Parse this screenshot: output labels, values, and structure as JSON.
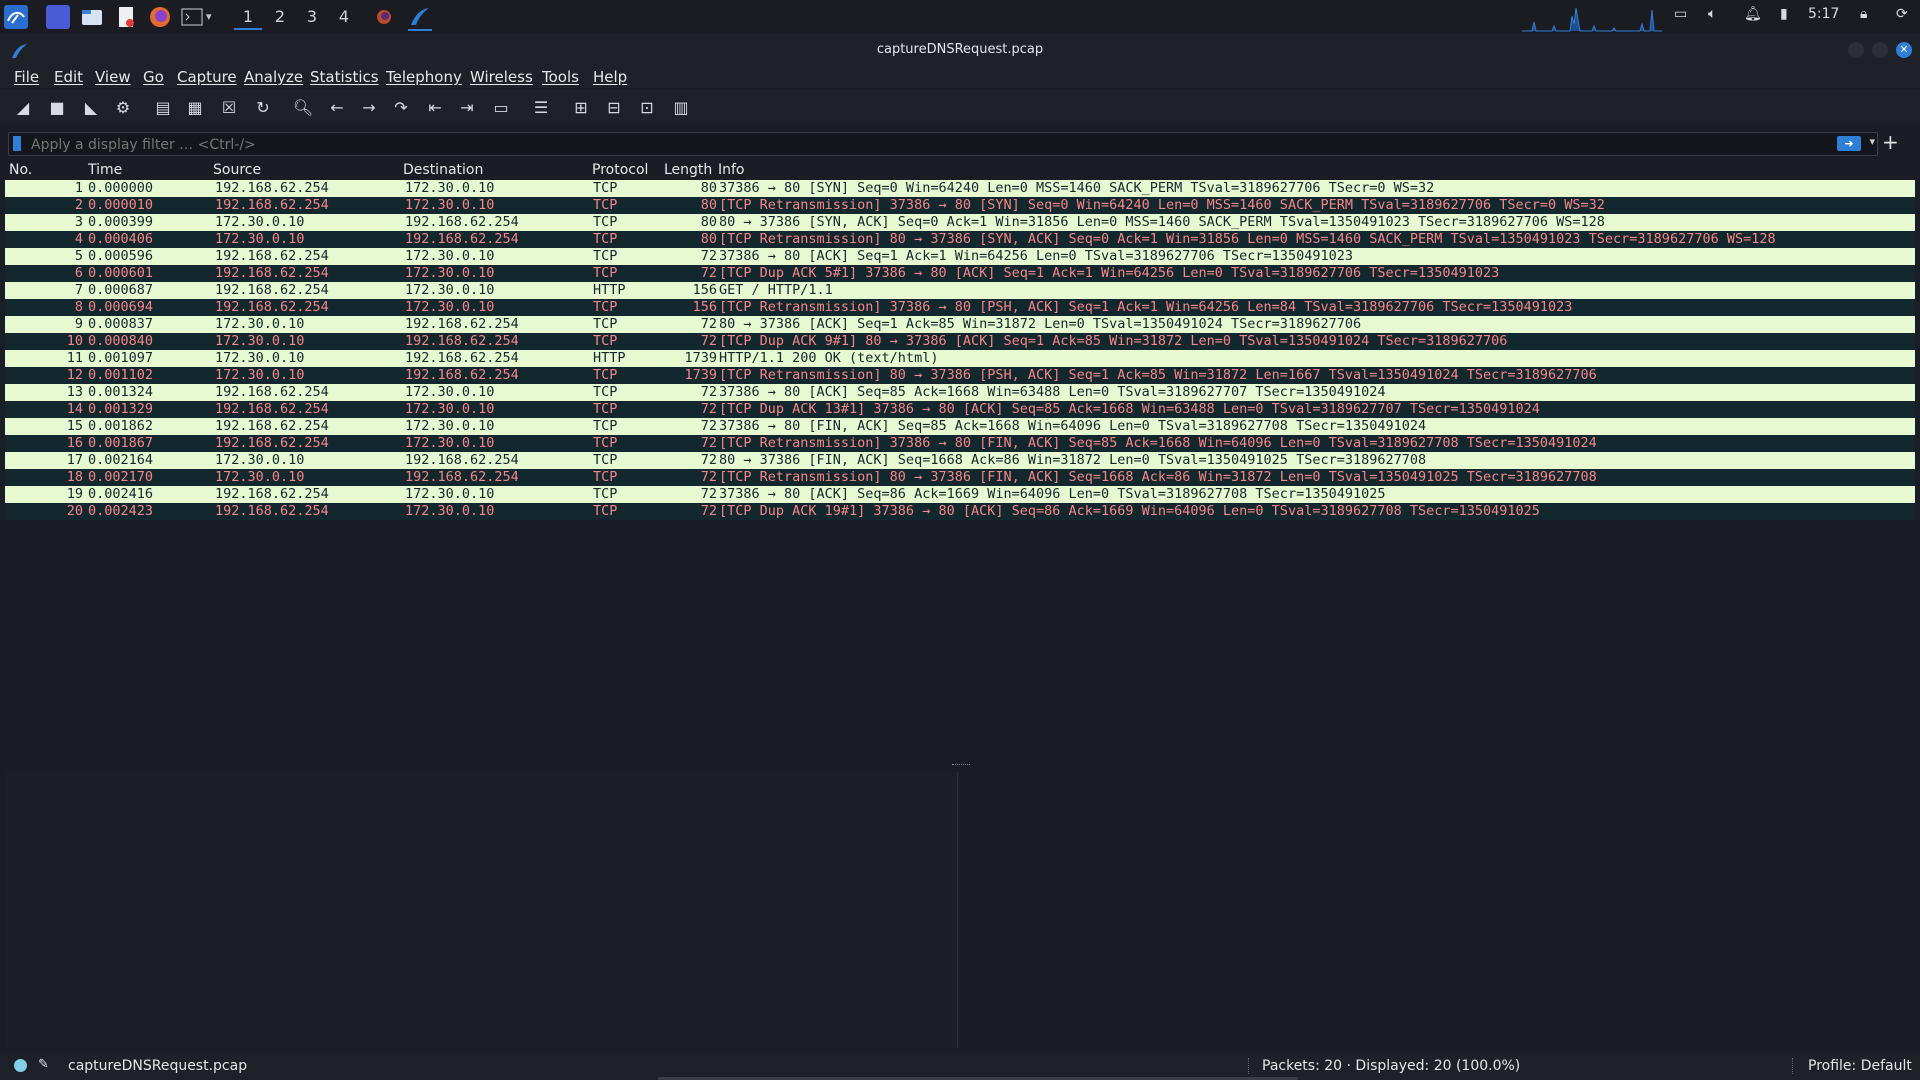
{
  "taskbar": {
    "workspaces": [
      "1",
      "2",
      "3",
      "4"
    ],
    "clock": "5:17"
  },
  "window": {
    "title": "captureDNSRequest.pcap"
  },
  "menu": [
    "File",
    "Edit",
    "View",
    "Go",
    "Capture",
    "Analyze",
    "Statistics",
    "Telephony",
    "Wireless",
    "Tools",
    "Help"
  ],
  "filter": {
    "placeholder": "Apply a display filter … <Ctrl-/>"
  },
  "columns": {
    "no": "No.",
    "time": "Time",
    "source": "Source",
    "destination": "Destination",
    "protocol": "Protocol",
    "length": "Length",
    "info": "Info"
  },
  "packets": [
    {
      "no": "1",
      "time": "0.000000",
      "src": "192.168.62.254",
      "dst": "172.30.0.10",
      "proto": "TCP",
      "len": "80",
      "info": "37386 → 80 [SYN] Seq=0 Win=64240 Len=0 MSS=1460 SACK_PERM TSval=3189627706 TSecr=0 WS=32",
      "style": "normal"
    },
    {
      "no": "2",
      "time": "0.000010",
      "src": "192.168.62.254",
      "dst": "172.30.0.10",
      "proto": "TCP",
      "len": "80",
      "info": "[TCP Retransmission] 37386 → 80 [SYN] Seq=0 Win=64240 Len=0 MSS=1460 SACK_PERM TSval=3189627706 TSecr=0 WS=32",
      "style": "bad"
    },
    {
      "no": "3",
      "time": "0.000399",
      "src": "172.30.0.10",
      "dst": "192.168.62.254",
      "proto": "TCP",
      "len": "80",
      "info": "80 → 37386 [SYN, ACK] Seq=0 Ack=1 Win=31856 Len=0 MSS=1460 SACK_PERM TSval=1350491023 TSecr=3189627706 WS=128",
      "style": "normal"
    },
    {
      "no": "4",
      "time": "0.000406",
      "src": "172.30.0.10",
      "dst": "192.168.62.254",
      "proto": "TCP",
      "len": "80",
      "info": "[TCP Retransmission] 80 → 37386 [SYN, ACK] Seq=0 Ack=1 Win=31856 Len=0 MSS=1460 SACK_PERM TSval=1350491023 TSecr=3189627706 WS=128",
      "style": "bad"
    },
    {
      "no": "5",
      "time": "0.000596",
      "src": "192.168.62.254",
      "dst": "172.30.0.10",
      "proto": "TCP",
      "len": "72",
      "info": "37386 → 80 [ACK] Seq=1 Ack=1 Win=64256 Len=0 TSval=3189627706 TSecr=1350491023",
      "style": "normal"
    },
    {
      "no": "6",
      "time": "0.000601",
      "src": "192.168.62.254",
      "dst": "172.30.0.10",
      "proto": "TCP",
      "len": "72",
      "info": "[TCP Dup ACK 5#1] 37386 → 80 [ACK] Seq=1 Ack=1 Win=64256 Len=0 TSval=3189627706 TSecr=1350491023",
      "style": "bad"
    },
    {
      "no": "7",
      "time": "0.000687",
      "src": "192.168.62.254",
      "dst": "172.30.0.10",
      "proto": "HTTP",
      "len": "156",
      "info": "GET / HTTP/1.1",
      "style": "normal"
    },
    {
      "no": "8",
      "time": "0.000694",
      "src": "192.168.62.254",
      "dst": "172.30.0.10",
      "proto": "TCP",
      "len": "156",
      "info": "[TCP Retransmission] 37386 → 80 [PSH, ACK] Seq=1 Ack=1 Win=64256 Len=84 TSval=3189627706 TSecr=1350491023",
      "style": "bad"
    },
    {
      "no": "9",
      "time": "0.000837",
      "src": "172.30.0.10",
      "dst": "192.168.62.254",
      "proto": "TCP",
      "len": "72",
      "info": "80 → 37386 [ACK] Seq=1 Ack=85 Win=31872 Len=0 TSval=1350491024 TSecr=3189627706",
      "style": "normal"
    },
    {
      "no": "10",
      "time": "0.000840",
      "src": "172.30.0.10",
      "dst": "192.168.62.254",
      "proto": "TCP",
      "len": "72",
      "info": "[TCP Dup ACK 9#1] 80 → 37386 [ACK] Seq=1 Ack=85 Win=31872 Len=0 TSval=1350491024 TSecr=3189627706",
      "style": "bad"
    },
    {
      "no": "11",
      "time": "0.001097",
      "src": "172.30.0.10",
      "dst": "192.168.62.254",
      "proto": "HTTP",
      "len": "1739",
      "info": "HTTP/1.1 200 OK  (text/html)",
      "style": "normal"
    },
    {
      "no": "12",
      "time": "0.001102",
      "src": "172.30.0.10",
      "dst": "192.168.62.254",
      "proto": "TCP",
      "len": "1739",
      "info": "[TCP Retransmission] 80 → 37386 [PSH, ACK] Seq=1 Ack=85 Win=31872 Len=1667 TSval=1350491024 TSecr=3189627706",
      "style": "bad"
    },
    {
      "no": "13",
      "time": "0.001324",
      "src": "192.168.62.254",
      "dst": "172.30.0.10",
      "proto": "TCP",
      "len": "72",
      "info": "37386 → 80 [ACK] Seq=85 Ack=1668 Win=63488 Len=0 TSval=3189627707 TSecr=1350491024",
      "style": "normal"
    },
    {
      "no": "14",
      "time": "0.001329",
      "src": "192.168.62.254",
      "dst": "172.30.0.10",
      "proto": "TCP",
      "len": "72",
      "info": "[TCP Dup ACK 13#1] 37386 → 80 [ACK] Seq=85 Ack=1668 Win=63488 Len=0 TSval=3189627707 TSecr=1350491024",
      "style": "bad"
    },
    {
      "no": "15",
      "time": "0.001862",
      "src": "192.168.62.254",
      "dst": "172.30.0.10",
      "proto": "TCP",
      "len": "72",
      "info": "37386 → 80 [FIN, ACK] Seq=85 Ack=1668 Win=64096 Len=0 TSval=3189627708 TSecr=1350491024",
      "style": "normal"
    },
    {
      "no": "16",
      "time": "0.001867",
      "src": "192.168.62.254",
      "dst": "172.30.0.10",
      "proto": "TCP",
      "len": "72",
      "info": "[TCP Retransmission] 37386 → 80 [FIN, ACK] Seq=85 Ack=1668 Win=64096 Len=0 TSval=3189627708 TSecr=1350491024",
      "style": "bad"
    },
    {
      "no": "17",
      "time": "0.002164",
      "src": "172.30.0.10",
      "dst": "192.168.62.254",
      "proto": "TCP",
      "len": "72",
      "info": "80 → 37386 [FIN, ACK] Seq=1668 Ack=86 Win=31872 Len=0 TSval=1350491025 TSecr=3189627708",
      "style": "normal"
    },
    {
      "no": "18",
      "time": "0.002170",
      "src": "172.30.0.10",
      "dst": "192.168.62.254",
      "proto": "TCP",
      "len": "72",
      "info": "[TCP Retransmission] 80 → 37386 [FIN, ACK] Seq=1668 Ack=86 Win=31872 Len=0 TSval=1350491025 TSecr=3189627708",
      "style": "bad"
    },
    {
      "no": "19",
      "time": "0.002416",
      "src": "192.168.62.254",
      "dst": "172.30.0.10",
      "proto": "TCP",
      "len": "72",
      "info": "37386 → 80 [ACK] Seq=86 Ack=1669 Win=64096 Len=0 TSval=3189627708 TSecr=1350491025",
      "style": "normal"
    },
    {
      "no": "20",
      "time": "0.002423",
      "src": "192.168.62.254",
      "dst": "172.30.0.10",
      "proto": "TCP",
      "len": "72",
      "info": "[TCP Dup ACK 19#1] 37386 → 80 [ACK] Seq=86 Ack=1669 Win=64096 Len=0 TSval=3189627708 TSecr=1350491025",
      "style": "bad"
    }
  ],
  "status": {
    "file": "captureDNSRequest.pcap",
    "packets": "Packets: 20 · Displayed: 20 (100.0%)",
    "profile": "Profile: Default"
  },
  "colors": {
    "normal_row_bg": "#e7f9d0",
    "normal_row_fg": "#12272e",
    "bad_row_bg": "#12272e",
    "bad_row_fg": "#f78787",
    "accent": "#2f7fd9"
  }
}
